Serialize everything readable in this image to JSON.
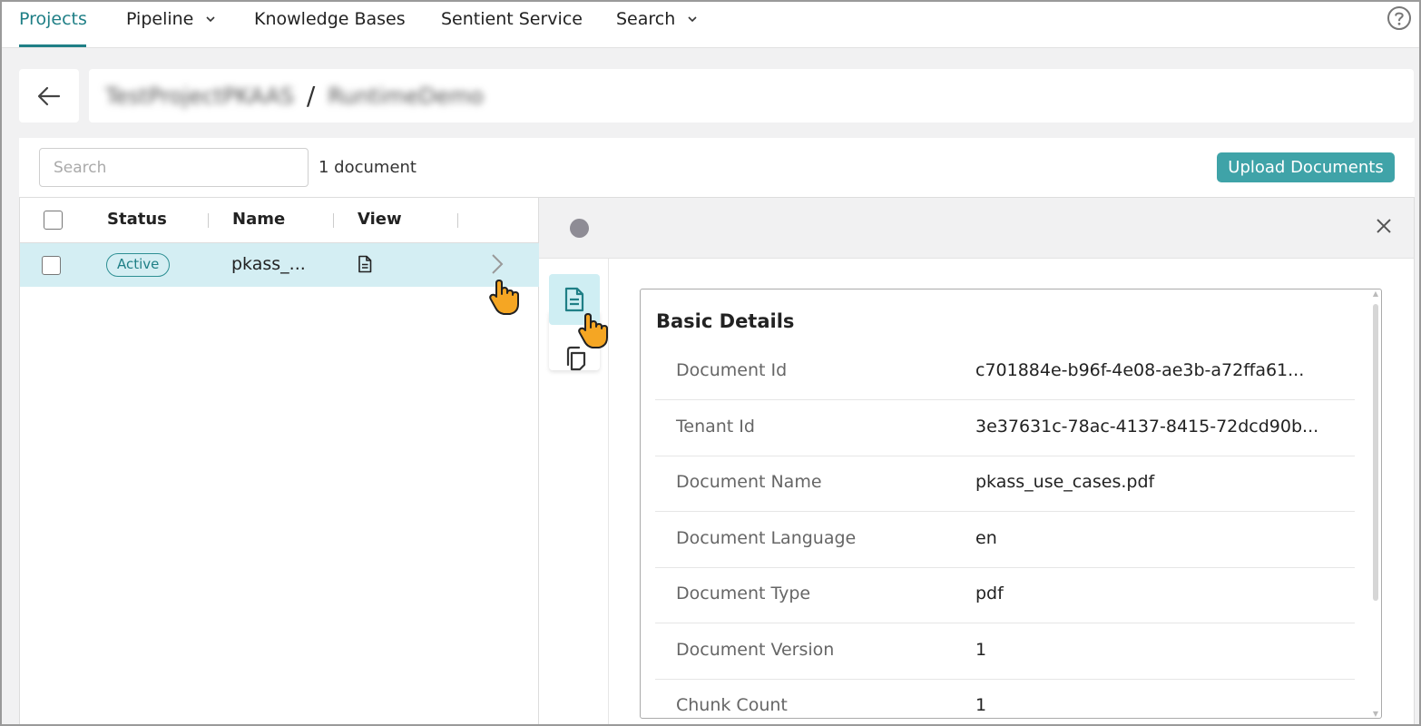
{
  "nav": {
    "items": [
      {
        "label": "Projects",
        "active": true,
        "dropdown": false
      },
      {
        "label": "Pipeline",
        "active": false,
        "dropdown": true
      },
      {
        "label": "Knowledge Bases",
        "active": false,
        "dropdown": false
      },
      {
        "label": "Sentient Service",
        "active": false,
        "dropdown": false
      },
      {
        "label": "Search",
        "active": false,
        "dropdown": true
      }
    ],
    "help_icon": "help-circle-icon"
  },
  "breadcrumb": {
    "back_icon": "arrow-left-icon",
    "project": "TestProjectPKAAS",
    "separator": "/",
    "kb": "RuntimeDemo"
  },
  "documents": {
    "search_placeholder": "Search",
    "count_label": "1 document",
    "upload_label": "Upload Documents",
    "columns": [
      "Status",
      "Name",
      "View"
    ],
    "rows": [
      {
        "status": "Active",
        "name": "pkass_...",
        "view_icon": "document-icon",
        "expand_icon": "chevron-right-icon"
      }
    ]
  },
  "detail": {
    "status_dot_color": "#8e8c95",
    "close_icon": "close-icon",
    "rail": [
      {
        "icon": "document-icon",
        "active": true
      },
      {
        "icon": "copy-pages-icon",
        "active": false
      }
    ],
    "section_title": "Basic Details",
    "fields": [
      {
        "label": "Document Id",
        "value": "c701884e-b96f-4e08-ae3b-a72ffa61..."
      },
      {
        "label": "Tenant Id",
        "value": "3e37631c-78ac-4137-8415-72dcd90b..."
      },
      {
        "label": "Document Name",
        "value": "pkass_use_cases.pdf"
      },
      {
        "label": "Document Language",
        "value": "en"
      },
      {
        "label": "Document Type",
        "value": "pdf"
      },
      {
        "label": "Document Version",
        "value": "1"
      },
      {
        "label": "Chunk Count",
        "value": "1"
      }
    ]
  },
  "colors": {
    "accent": "#1f7f86",
    "button": "#3fa3a8",
    "selected_row": "#d4eef3"
  }
}
